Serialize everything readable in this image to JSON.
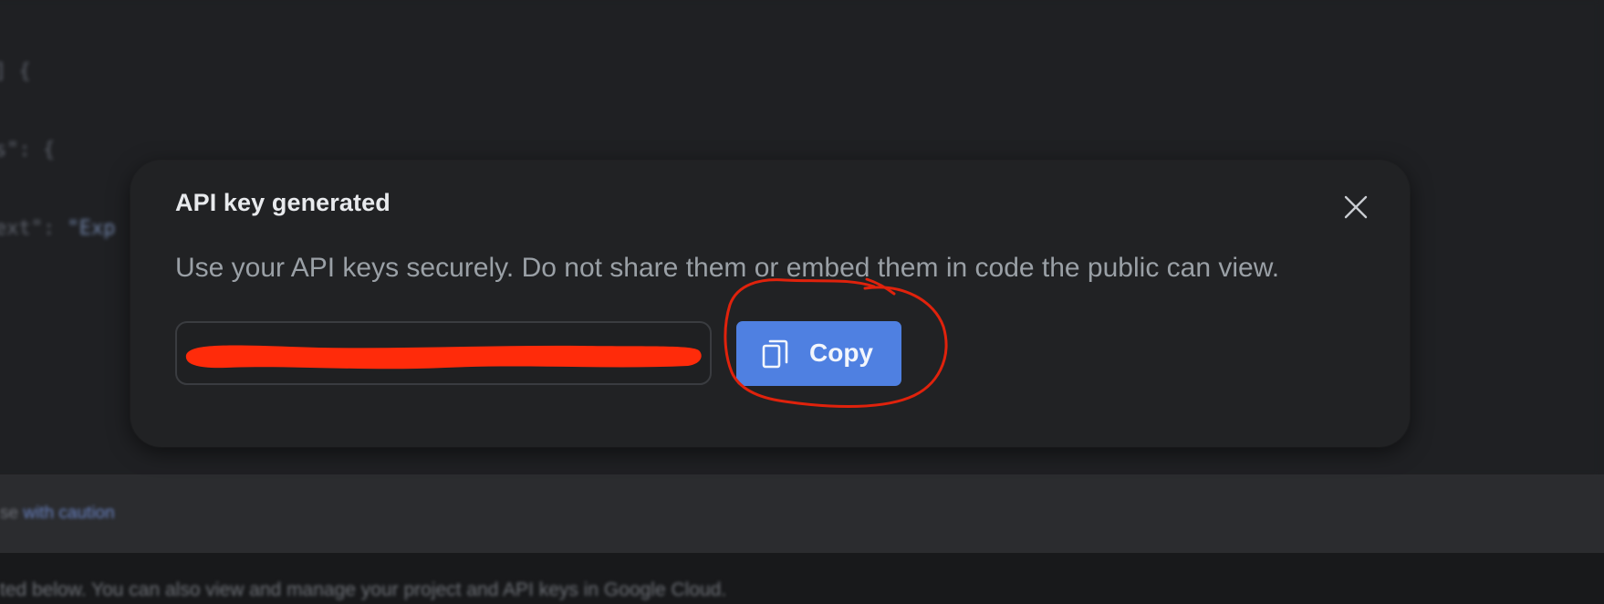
{
  "background": {
    "code_lines": [
      {
        "text": "  ] {",
        "str": ""
      },
      {
        "text": "  s\": {",
        "str": ""
      },
      {
        "text": "  ext\": ",
        "str": "\"Exp"
      }
    ],
    "notice_prefix": "se ",
    "notice_link": "with caution",
    "footer_text": "ted below. You can also view and manage your project and API keys in Google Cloud."
  },
  "dialog": {
    "title": "API key generated",
    "description": "Use your API keys securely. Do not share them or embed them in code the public can view.",
    "key_field": {
      "value": "",
      "redacted": true
    },
    "copy_button": {
      "label": "Copy",
      "icon": "copy-icon",
      "color": "#4f80e1"
    },
    "close_icon": "close-icon"
  },
  "annotation": {
    "shape": "freehand-circle",
    "color": "#e0220c",
    "target": "copy-button"
  },
  "colors": {
    "page_bg": "#1f2023",
    "dialog_bg": "#212224",
    "redaction": "#ff2b0a"
  }
}
